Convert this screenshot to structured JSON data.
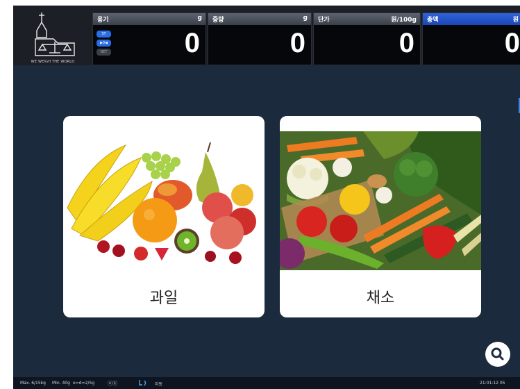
{
  "header": {
    "logo_text": "WE WEIGH THE WORLD",
    "indicators": [
      "ST",
      "▶0◀",
      "NET"
    ],
    "panels": [
      {
        "label": "용기",
        "unit": "g",
        "value": "0"
      },
      {
        "label": "중량",
        "unit": "g",
        "value": "0"
      },
      {
        "label": "단가",
        "unit": "원/100g",
        "value": "0"
      },
      {
        "label": "총액",
        "unit": "원",
        "value": "0"
      }
    ]
  },
  "categories": [
    {
      "label": "과일",
      "icon": "fruit-image"
    },
    {
      "label": "채소",
      "icon": "vegetable-image"
    }
  ],
  "search": {
    "icon": "search-icon"
  },
  "status_bar": {
    "max": "Max. 6/15kg",
    "min": "Min. 40g",
    "e": "e=d=2/5g",
    "mode": "자동",
    "clock": "21:01:12 05"
  },
  "colors": {
    "background": "#1b2a3c",
    "header": "#1c1f26",
    "accent": "#2a6de4"
  }
}
